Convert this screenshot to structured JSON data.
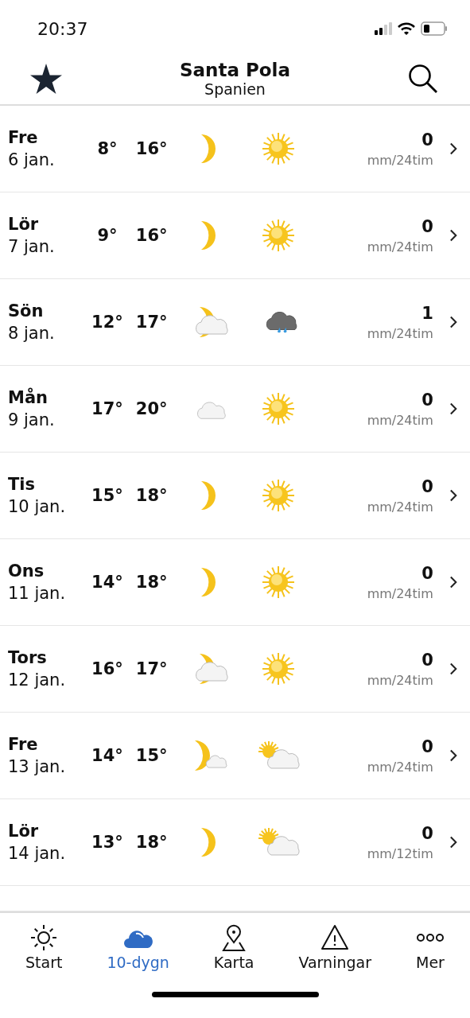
{
  "status_bar": {
    "time": "20:37"
  },
  "header": {
    "title": "Santa Pola",
    "subtitle": "Spanien"
  },
  "days": [
    {
      "day": "Fre",
      "date": "6 jan.",
      "low": "8°",
      "high": "16°",
      "night": {
        "kind": "moon"
      },
      "daytime": {
        "kind": "sun"
      },
      "precip": "0",
      "unit": "mm/24tim"
    },
    {
      "day": "Lör",
      "date": "7 jan.",
      "low": "9°",
      "high": "16°",
      "night": {
        "kind": "moon"
      },
      "daytime": {
        "kind": "sun"
      },
      "precip": "0",
      "unit": "mm/24tim"
    },
    {
      "day": "Sön",
      "date": "8 jan.",
      "low": "12°",
      "high": "17°",
      "night": {
        "kind": "moon-cloud"
      },
      "daytime": {
        "kind": "rain"
      },
      "precip": "1",
      "unit": "mm/24tim"
    },
    {
      "day": "Mån",
      "date": "9 jan.",
      "low": "17°",
      "high": "20°",
      "night": {
        "kind": "cloud"
      },
      "daytime": {
        "kind": "sun"
      },
      "precip": "0",
      "unit": "mm/24tim"
    },
    {
      "day": "Tis",
      "date": "10 jan.",
      "low": "15°",
      "high": "18°",
      "night": {
        "kind": "moon"
      },
      "daytime": {
        "kind": "sun"
      },
      "precip": "0",
      "unit": "mm/24tim"
    },
    {
      "day": "Ons",
      "date": "11 jan.",
      "low": "14°",
      "high": "18°",
      "night": {
        "kind": "moon"
      },
      "daytime": {
        "kind": "sun"
      },
      "precip": "0",
      "unit": "mm/24tim"
    },
    {
      "day": "Tors",
      "date": "12 jan.",
      "low": "16°",
      "high": "17°",
      "night": {
        "kind": "moon-cloud"
      },
      "daytime": {
        "kind": "sun"
      },
      "precip": "0",
      "unit": "mm/24tim"
    },
    {
      "day": "Fre",
      "date": "13 jan.",
      "low": "14°",
      "high": "15°",
      "night": {
        "kind": "moon-small-cloud"
      },
      "daytime": {
        "kind": "sun-cloud"
      },
      "precip": "0",
      "unit": "mm/24tim"
    },
    {
      "day": "Lör",
      "date": "14 jan.",
      "low": "13°",
      "high": "18°",
      "night": {
        "kind": "moon"
      },
      "daytime": {
        "kind": "sun-cloud"
      },
      "precip": "0",
      "unit": "mm/12tim"
    }
  ],
  "tab_bar": [
    {
      "label": "Start",
      "kind": "sun",
      "selected": false
    },
    {
      "label": "10-dygn",
      "kind": "cloud",
      "selected": true
    },
    {
      "label": "Karta",
      "kind": "map",
      "selected": false
    },
    {
      "label": "Varningar",
      "kind": "warning",
      "selected": false
    },
    {
      "label": "Mer",
      "kind": "more",
      "selected": false
    }
  ]
}
